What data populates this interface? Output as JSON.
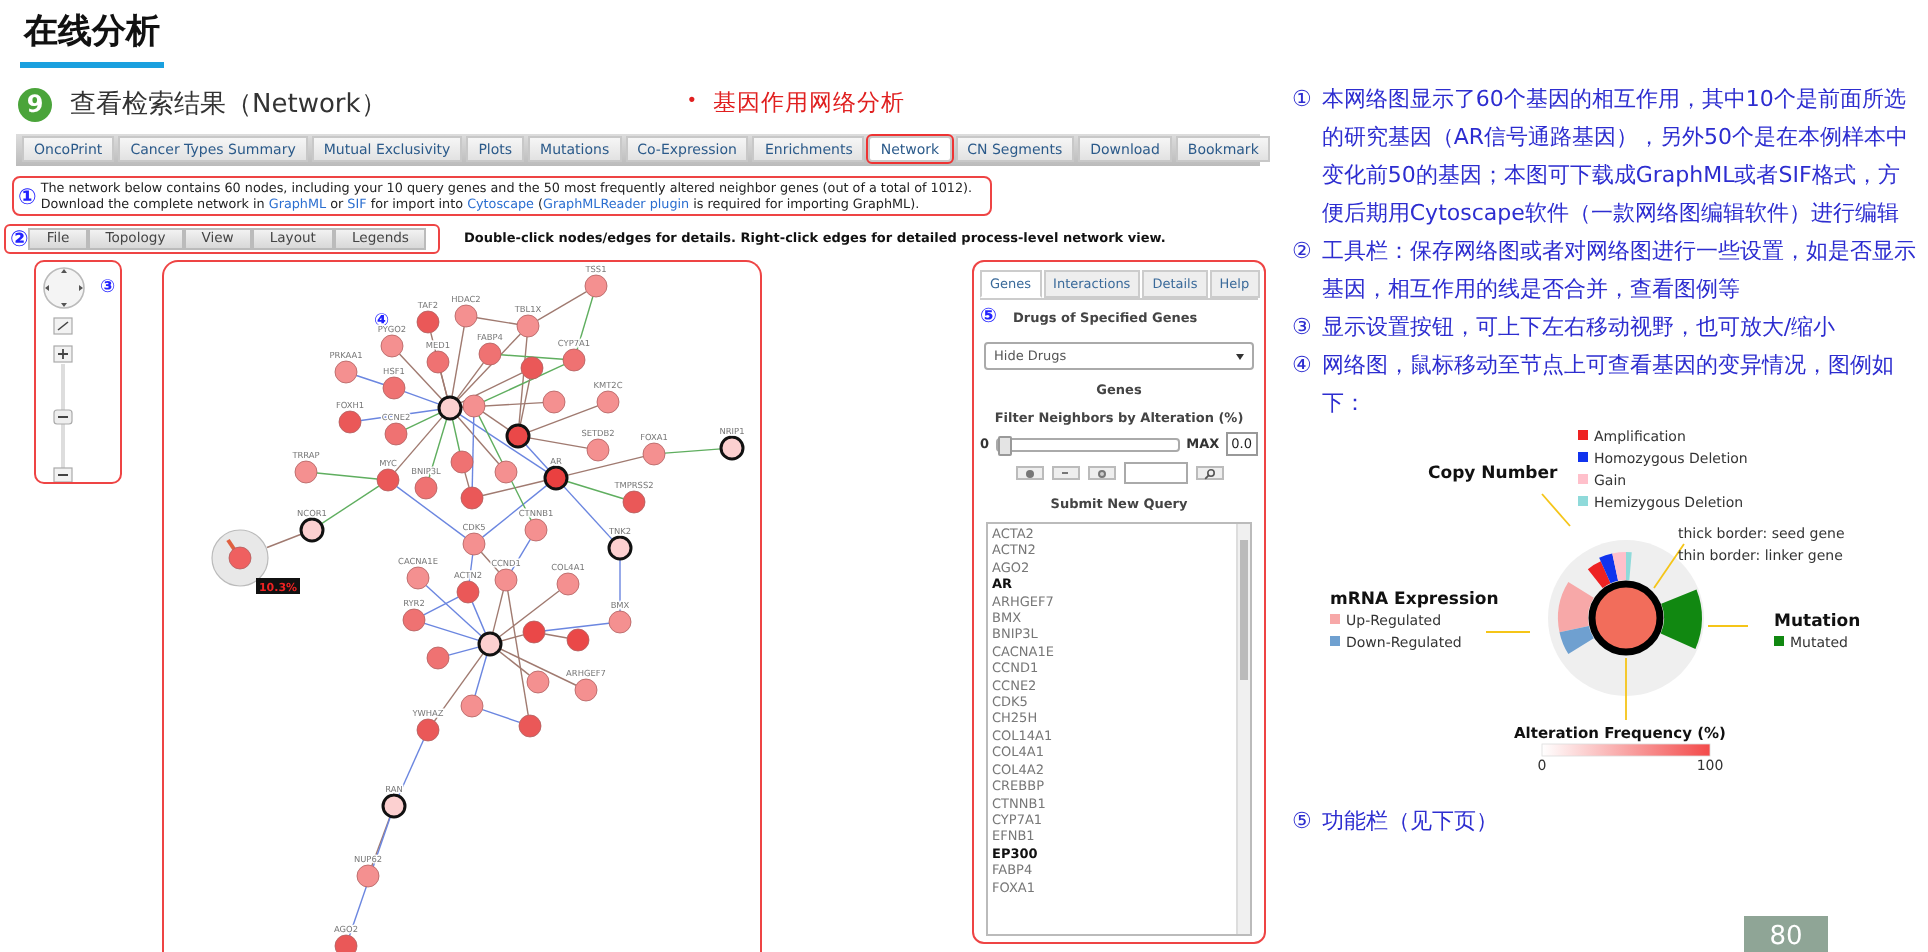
{
  "slide_title": "在线分析",
  "step": {
    "number": "9",
    "title": "查看检索结果（Network）"
  },
  "callout": {
    "bullet": "•",
    "text": "基因作用网络分析"
  },
  "tabs": [
    {
      "label": "OncoPrint",
      "selected": false
    },
    {
      "label": "Cancer Types Summary",
      "selected": false
    },
    {
      "label": "Mutual Exclusivity",
      "selected": false
    },
    {
      "label": "Plots",
      "selected": false
    },
    {
      "label": "Mutations",
      "selected": false
    },
    {
      "label": "Co-Expression",
      "selected": false
    },
    {
      "label": "Enrichments",
      "selected": false
    },
    {
      "label": "Network",
      "selected": true
    },
    {
      "label": "CN Segments",
      "selected": false
    },
    {
      "label": "Download",
      "selected": false
    },
    {
      "label": "Bookmark",
      "selected": false
    }
  ],
  "info": {
    "marker": "①",
    "line1": "The network below contains 60 nodes, including your 10 query genes and the 50 most frequently altered neighbor genes (out of a total of 1012).",
    "line2": [
      {
        "text": "Download the complete network in ",
        "link": false
      },
      {
        "text": "GraphML",
        "link": true
      },
      {
        "text": " or ",
        "link": false
      },
      {
        "text": "SIF",
        "link": true
      },
      {
        "text": " for import into ",
        "link": false
      },
      {
        "text": "Cytoscape",
        "link": true
      },
      {
        "text": " (",
        "link": false
      },
      {
        "text": "GraphMLReader plugin",
        "link": true
      },
      {
        "text": " is required for importing GraphML).",
        "link": false
      }
    ]
  },
  "toolbar": {
    "marker": "②",
    "buttons": [
      "File",
      "Topology",
      "View",
      "Layout",
      "Legends"
    ],
    "hint": "Double-click nodes/edges for details. Right-click edges for detailed process-level network view."
  },
  "view_controls": {
    "marker": "③"
  },
  "network": {
    "marker": "④",
    "tooltip": "10.3%",
    "nodes": [
      {
        "label": "TSS1",
        "seed": false,
        "color": "#f49090"
      },
      {
        "label": "TAF2",
        "seed": false,
        "color": "#ea5858"
      },
      {
        "label": "HDAC2",
        "seed": false,
        "color": "#f49090"
      },
      {
        "label": "TBL1X",
        "seed": false,
        "color": "#f49090"
      },
      {
        "label": "PYGO2",
        "seed": false,
        "color": "#f49090"
      },
      {
        "label": "FABP4",
        "seed": false,
        "color": "#ef7272"
      },
      {
        "label": "CYP7A1",
        "seed": false,
        "color": "#ef7272"
      },
      {
        "label": "MED1",
        "seed": false,
        "color": "#ef7272"
      },
      {
        "seed": false,
        "color": "#ea5858"
      },
      {
        "label": "PRKAA1",
        "seed": false,
        "color": "#f49090"
      },
      {
        "label": "HSF1",
        "seed": false,
        "color": "#ef7272"
      },
      {
        "seed": false,
        "color": "#f49090"
      },
      {
        "label": "KMT2C",
        "seed": false,
        "color": "#f49090"
      },
      {
        "seed": true,
        "color": "#fcd0d0"
      },
      {
        "seed": false,
        "color": "#f49090"
      },
      {
        "label": "FOXH1",
        "seed": false,
        "color": "#ea5858"
      },
      {
        "label": "CCNE2",
        "seed": false,
        "color": "#ef7272"
      },
      {
        "seed": true,
        "color": "#ea4848"
      },
      {
        "label": "SETDB2",
        "seed": false,
        "color": "#f49090"
      },
      {
        "label": "FOXA1",
        "seed": false,
        "color": "#f49090"
      },
      {
        "label": "NRIP1",
        "seed": true,
        "color": "#fcd0d0"
      },
      {
        "label": "TRRAP",
        "seed": false,
        "color": "#f49090"
      },
      {
        "label": "MYC",
        "seed": false,
        "color": "#ea5858"
      },
      {
        "label": "BNIP3L",
        "seed": false,
        "color": "#ef7272"
      },
      {
        "seed": false,
        "color": "#ef7272"
      },
      {
        "seed": false,
        "color": "#f49090"
      },
      {
        "label": "AR",
        "seed": true,
        "color": "#ea4040"
      },
      {
        "label": "TMPRSS2",
        "seed": false,
        "color": "#ea5858"
      },
      {
        "seed": false,
        "color": "#ea5858"
      },
      {
        "label": "NCOR1",
        "seed": true,
        "color": "#fcd0d0"
      },
      {
        "label": "CTNNB1",
        "seed": false,
        "color": "#f49090"
      },
      {
        "label": "CDK5",
        "seed": false,
        "color": "#f49090"
      },
      {
        "label": "TNK2",
        "seed": true,
        "color": "#fcd0d0"
      },
      {
        "seed": false,
        "color": "#ef6060"
      },
      {
        "label": "CACNA1E",
        "seed": false,
        "color": "#f49090"
      },
      {
        "label": "ACTN2",
        "seed": false,
        "color": "#ea5858"
      },
      {
        "label": "CCND1",
        "seed": false,
        "color": "#f49090"
      },
      {
        "label": "COL4A1",
        "seed": false,
        "color": "#f49090"
      },
      {
        "label": "RYR2",
        "seed": false,
        "color": "#ef7272"
      },
      {
        "label": "BMX",
        "seed": false,
        "color": "#f49090"
      },
      {
        "seed": true,
        "color": "#fcd0d0"
      },
      {
        "seed": false,
        "color": "#ea4848"
      },
      {
        "seed": false,
        "color": "#ea4848"
      },
      {
        "seed": false,
        "color": "#ef7272"
      },
      {
        "seed": false,
        "color": "#f49090"
      },
      {
        "label": "ARHGEF7",
        "seed": false,
        "color": "#f49090"
      },
      {
        "seed": false,
        "color": "#f49090"
      },
      {
        "seed": false,
        "color": "#ea5858"
      },
      {
        "label": "YWHAZ",
        "seed": false,
        "color": "#ea5858"
      },
      {
        "label": "RAN",
        "seed": true,
        "color": "#fcd0d0"
      },
      {
        "label": "NUP62",
        "seed": false,
        "color": "#f49090"
      },
      {
        "label": "AGO2",
        "seed": false,
        "color": "#ea5858"
      }
    ]
  },
  "side_panel": {
    "tabs": [
      {
        "label": "Genes",
        "selected": true
      },
      {
        "label": "Interactions",
        "selected": false
      },
      {
        "label": "Details",
        "selected": false
      },
      {
        "label": "Help",
        "selected": false
      }
    ],
    "marker": "⑤",
    "drugs_heading": "Drugs of Specified Genes",
    "drug_select": "Hide Drugs",
    "genes_heading": "Genes",
    "filter_label": "Filter Neighbors by Alteration (%)",
    "slider_min": "0",
    "slider": {
      "level": 0
    },
    "slider_max": "MAX",
    "filter_value": "0.0",
    "submit": "Submit New Query",
    "genes": [
      {
        "name": "ACTA2",
        "query": false
      },
      {
        "name": "ACTN2",
        "query": false
      },
      {
        "name": "AGO2",
        "query": false
      },
      {
        "name": "AR",
        "query": true
      },
      {
        "name": "ARHGEF7",
        "query": false
      },
      {
        "name": "BMX",
        "query": false
      },
      {
        "name": "BNIP3L",
        "query": false
      },
      {
        "name": "CACNA1E",
        "query": false
      },
      {
        "name": "CCND1",
        "query": false
      },
      {
        "name": "CCNE2",
        "query": false
      },
      {
        "name": "CDK5",
        "query": false
      },
      {
        "name": "CH25H",
        "query": false
      },
      {
        "name": "COL14A1",
        "query": false
      },
      {
        "name": "COL4A1",
        "query": false
      },
      {
        "name": "COL4A2",
        "query": false
      },
      {
        "name": "CREBBP",
        "query": false
      },
      {
        "name": "CTNNB1",
        "query": false
      },
      {
        "name": "CYP7A1",
        "query": false
      },
      {
        "name": "EFNB1",
        "query": false
      },
      {
        "name": "EP300",
        "query": true
      },
      {
        "name": "FABP4",
        "query": false
      },
      {
        "name": "FOXA1",
        "query": false
      }
    ]
  },
  "notes": [
    {
      "marker": "①",
      "text": "本网络图显示了60个基因的相互作用，其中10个是前面所选的研究基因（AR信号通路基因），另外50个是在本例样本中变化前50的基因；本图可下载成GraphML或者SIF格式，方便后期用Cytoscape软件（一款网络图编辑软件）进行编辑"
    },
    {
      "marker": "②",
      "text": "工具栏：保存网络图或者对网络图进行一些设置，如是否显示基因，相互作用的线是否合并，查看图例等"
    },
    {
      "marker": "③",
      "text": "显示设置按钮，可上下左右移动视野，也可放大/缩小"
    },
    {
      "marker": "④",
      "text": "网络图，鼠标移动至节点上可查看基因的变异情况，图例如下："
    }
  ],
  "legend": {
    "copy_number": {
      "title": "Copy Number",
      "items": [
        {
          "label": "Amplification",
          "color": "#ee2222"
        },
        {
          "label": "Homozygous Deletion",
          "color": "#1133ee"
        },
        {
          "label": "Gain",
          "color": "#ffc0cb"
        },
        {
          "label": "Hemizygous Deletion",
          "color": "#8fdada"
        }
      ]
    },
    "border_notes": [
      "thick border: seed gene",
      "thin border: linker gene"
    ],
    "mrna": {
      "title": "mRNA Expression",
      "items": [
        {
          "label": "Up-Regulated",
          "color": "#f7a8a8"
        },
        {
          "label": "Down-Regulated",
          "color": "#6fa0d0"
        }
      ]
    },
    "mutation": {
      "title": "Mutation",
      "items": [
        {
          "label": "Mutated",
          "color": "#118811"
        }
      ]
    },
    "frequency": {
      "title": "Alteration Frequency (%)",
      "min": "0",
      "max": "100"
    }
  },
  "footer_note": {
    "marker": "⑤",
    "text": "功能栏（见下页）"
  },
  "page_number": "80"
}
